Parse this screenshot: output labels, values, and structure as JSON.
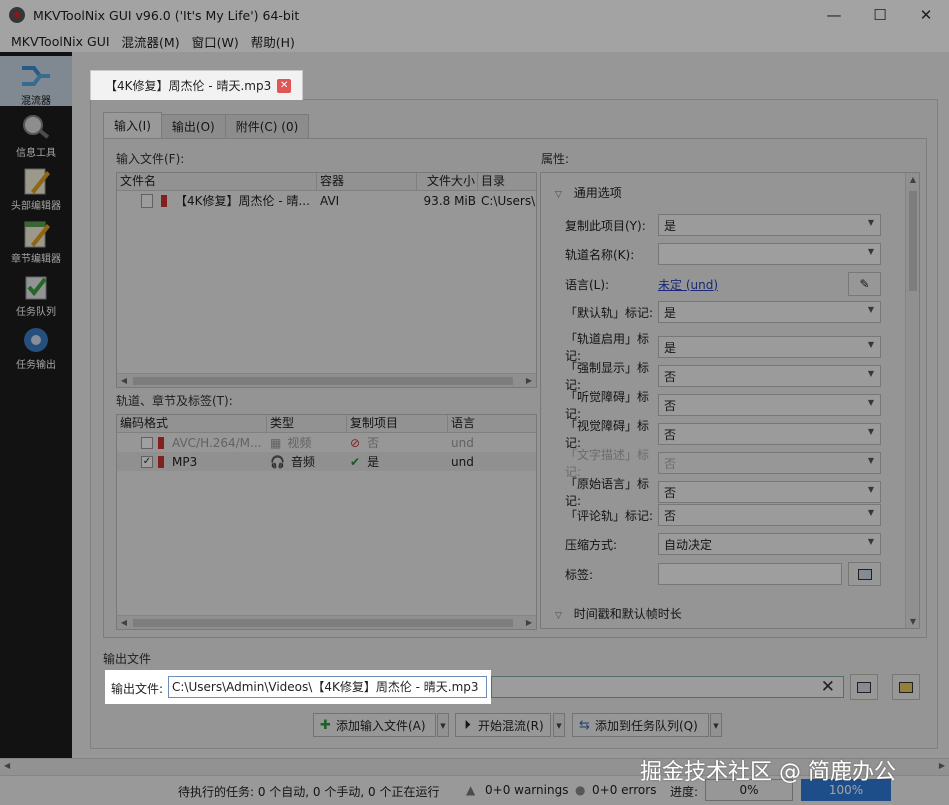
{
  "window": {
    "title": "MKVToolNix GUI v96.0 ('It's My Life') 64-bit",
    "minimize": "—",
    "maximize": "☐",
    "close": "✕"
  },
  "menu": [
    "MKVToolNix GUI",
    "混流器(M)",
    "窗口(W)",
    "帮助(H)"
  ],
  "sidebar": [
    {
      "label": "混流器",
      "icon": "multiplexer-icon",
      "active": true
    },
    {
      "label": "信息工具",
      "icon": "info-tool-icon"
    },
    {
      "label": "头部编辑器",
      "icon": "header-editor-icon"
    },
    {
      "label": "章节编辑器",
      "icon": "chapter-editor-icon"
    },
    {
      "label": "任务队列",
      "icon": "job-queue-icon"
    },
    {
      "label": "任务输出",
      "icon": "job-output-icon"
    }
  ],
  "doc_tab": {
    "label": "【4K修复】周杰伦 - 晴天.mp3"
  },
  "subtabs": [
    "输入(I)",
    "输出(O)",
    "附件(C) (0)"
  ],
  "input_files": {
    "label": "输入文件(F):",
    "headers": [
      "文件名",
      "容器",
      "文件大小",
      "目录"
    ],
    "rows": [
      {
        "name": "【4K修复】周杰伦 - 晴...",
        "container": "AVI",
        "size": "93.8 MiB",
        "dir": "C:\\Users\\"
      }
    ]
  },
  "tracks": {
    "label": "轨道、章节及标签(T):",
    "headers": [
      "编码格式",
      "类型",
      "复制项目",
      "语言"
    ],
    "rows": [
      {
        "codec": "AVC/H.264/M...",
        "type": "视频",
        "copy": "否",
        "lang": "und",
        "checked": false
      },
      {
        "codec": "MP3",
        "type": "音频",
        "copy": "是",
        "lang": "und",
        "checked": true
      }
    ]
  },
  "properties": {
    "label": "属性:",
    "section_general": "通用选项",
    "section_timing": "时间戳和默认帧时长",
    "rows": [
      {
        "label": "复制此项目(Y):",
        "value": "是",
        "kind": "combo"
      },
      {
        "label": "轨道名称(K):",
        "value": "",
        "kind": "combo"
      },
      {
        "label": "语言(L):",
        "value": "未定 (und)",
        "kind": "link"
      },
      {
        "label": "「默认轨」标记:",
        "value": "是",
        "kind": "combo"
      },
      {
        "label": "「轨道启用」标记:",
        "value": "是",
        "kind": "combo"
      },
      {
        "label": "「强制显示」标记:",
        "value": "否",
        "kind": "combo"
      },
      {
        "label": "「听觉障碍」标记:",
        "value": "否",
        "kind": "combo"
      },
      {
        "label": "「视觉障碍」标记:",
        "value": "否",
        "kind": "combo"
      },
      {
        "label": "「文字描述」标记:",
        "value": "否",
        "kind": "combo-disabled"
      },
      {
        "label": "「原始语言」标记:",
        "value": "否",
        "kind": "combo"
      },
      {
        "label": "「评论轨」标记:",
        "value": "否",
        "kind": "combo"
      },
      {
        "label": "压缩方式:",
        "value": "自动决定",
        "kind": "combo"
      },
      {
        "label": "标签:",
        "value": "",
        "kind": "text"
      }
    ]
  },
  "output": {
    "section": "输出文件",
    "label": "输出文件:",
    "value": "C:\\Users\\Admin\\Videos\\【4K修复】周杰伦 - 晴天.mp3"
  },
  "actions": {
    "add_input": "添加输入文件(A)",
    "start_mux": "开始混流(R)",
    "add_queue": "添加到任务队列(Q)"
  },
  "status": {
    "pending": "待执行的任务: 0 个自动, 0 个手动, 0 个正在运行",
    "warnings": "0+0 warnings",
    "errors": "0+0 errors",
    "progress_label": "进度:",
    "progress_current": "0%",
    "progress_total": "100%"
  },
  "watermark": "掘金技术社区 @ 简鹿办公"
}
